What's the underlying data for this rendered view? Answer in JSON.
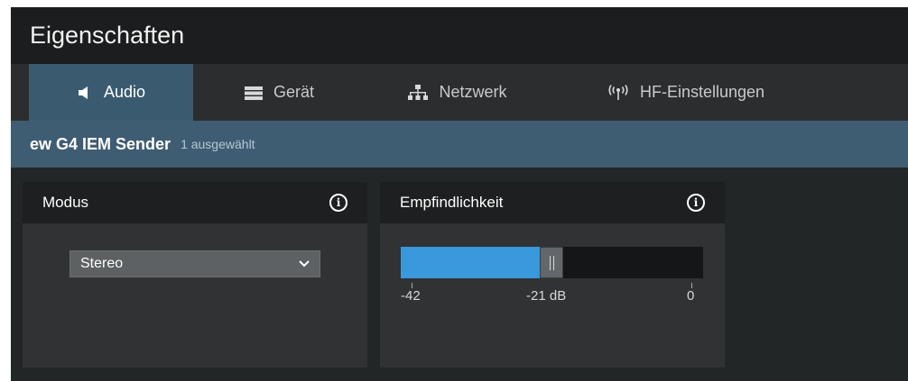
{
  "window": {
    "title": "Eigenschaften"
  },
  "tabs": [
    {
      "label": "Audio",
      "icon": "speaker-icon",
      "active": true
    },
    {
      "label": "Gerät",
      "icon": "device-icon",
      "active": false
    },
    {
      "label": "Netzwerk",
      "icon": "network-icon",
      "active": false
    },
    {
      "label": "HF-Einstellungen",
      "icon": "antenna-icon",
      "active": false
    }
  ],
  "device": {
    "name": "ew G4 IEM Sender",
    "selection": "1 ausgewählt"
  },
  "modus": {
    "title": "Modus",
    "value": "Stereo"
  },
  "sensitivity": {
    "title": "Empfindlichkeit",
    "min": -42,
    "max": 0,
    "value": -21,
    "ticks": [
      "-42",
      "-21 dB",
      "0"
    ]
  },
  "colors": {
    "accent": "#3a98dc",
    "tab_active": "#3a5a70",
    "device_bar": "#3f5d72"
  }
}
